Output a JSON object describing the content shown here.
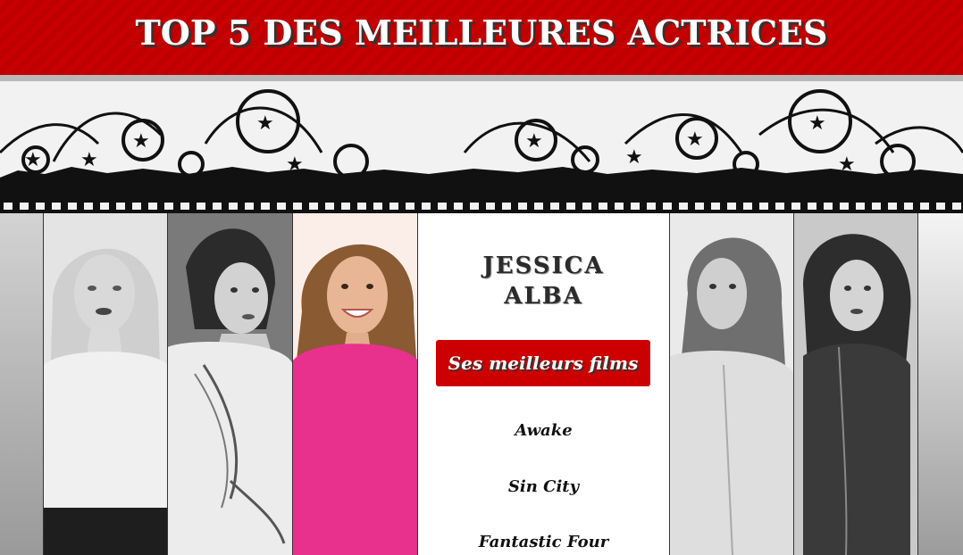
{
  "header": {
    "title": "TOP 5 DES MEILLEURES ACTRICES"
  },
  "colors": {
    "brand_red": "#cc0000",
    "dress_pink": "#e8318c"
  },
  "gallery": [
    {
      "id": "actress-1",
      "tone": "grayscale"
    },
    {
      "id": "actress-2",
      "tone": "grayscale"
    },
    {
      "id": "actress-3",
      "tone": "color"
    },
    {
      "id": "actress-4",
      "tone": "grayscale"
    },
    {
      "id": "actress-5",
      "tone": "grayscale"
    }
  ],
  "featured": {
    "name_line1": "JESSICA",
    "name_line2": "ALBA",
    "films_button": "Ses meilleurs films",
    "films": [
      "Awake",
      "Sin City",
      "Fantastic Four"
    ]
  }
}
